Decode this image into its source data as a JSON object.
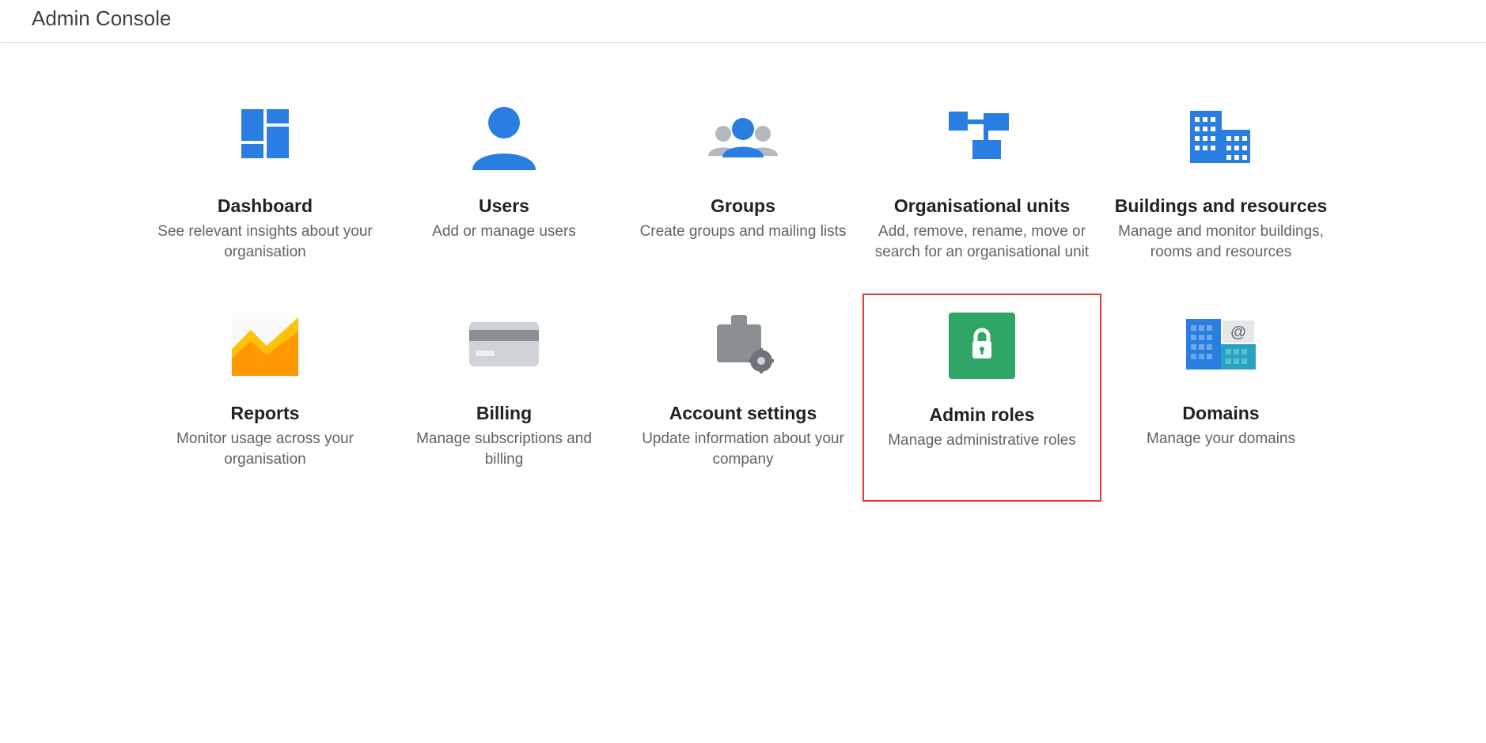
{
  "header": {
    "title": "Admin Console"
  },
  "tiles": [
    {
      "title": "Dashboard",
      "desc": "See relevant insights about your organisation"
    },
    {
      "title": "Users",
      "desc": "Add or manage users"
    },
    {
      "title": "Groups",
      "desc": "Create groups and mailing lists"
    },
    {
      "title": "Organisational units",
      "desc": "Add, remove, rename, move or search for an organisational unit"
    },
    {
      "title": "Buildings and resources",
      "desc": "Manage and monitor buildings, rooms and resources"
    },
    {
      "title": "Reports",
      "desc": "Monitor usage across your organisation"
    },
    {
      "title": "Billing",
      "desc": "Manage subscriptions and billing"
    },
    {
      "title": "Account settings",
      "desc": "Update information about your company"
    },
    {
      "title": "Admin roles",
      "desc": "Manage administrative roles"
    },
    {
      "title": "Domains",
      "desc": "Manage your domains"
    }
  ],
  "highlightIndex": 8
}
